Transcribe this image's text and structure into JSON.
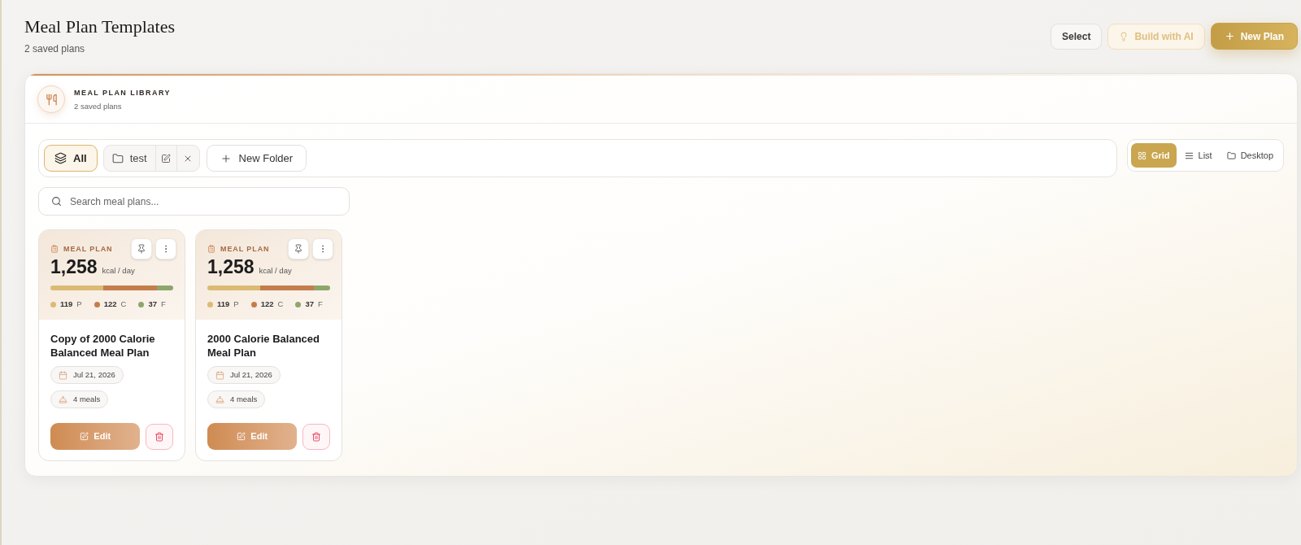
{
  "header": {
    "title": "Meal Plan Templates",
    "subtitle": "2 saved plans",
    "actions": [
      {
        "kind": "outline",
        "label": "Select",
        "disabled": false
      },
      {
        "kind": "ai",
        "label": "Build with AI",
        "disabled": true
      },
      {
        "kind": "primary",
        "label": "New Plan",
        "disabled": false
      }
    ]
  },
  "library": {
    "label": "MEAL PLAN LIBRARY",
    "subtitle": "2 saved plans"
  },
  "folders": {
    "items": [
      {
        "kind": "all",
        "label": "All",
        "selected": true
      },
      {
        "kind": "folder",
        "label": "test",
        "selected": false
      }
    ],
    "new_folder": "New Folder"
  },
  "views": [
    {
      "kind": "grid",
      "label": "Grid",
      "selected": true
    },
    {
      "kind": "list",
      "label": "List",
      "selected": false
    },
    {
      "kind": "desktop",
      "label": "Desktop",
      "selected": false
    }
  ],
  "search": {
    "placeholder": "Search meal plans..."
  },
  "plans": [
    {
      "tag": "MEAL PLAN",
      "calories": "1,258",
      "unit": "kcal / day",
      "macros": [
        {
          "value": "119",
          "letter": "P",
          "color": "#dbbb73"
        },
        {
          "value": "122",
          "letter": "C",
          "color": "#c47d4b"
        },
        {
          "value": "37",
          "letter": "F",
          "color": "#8ea66b"
        }
      ],
      "title": "Copy of 2000 Calorie Balanced Meal Plan",
      "date": "Jul 21, 2026",
      "meals": "4 meals",
      "edit": "Edit"
    },
    {
      "tag": "MEAL PLAN",
      "calories": "1,258",
      "unit": "kcal / day",
      "macros": [
        {
          "value": "119",
          "letter": "P",
          "color": "#dbbb73"
        },
        {
          "value": "122",
          "letter": "C",
          "color": "#c47d4b"
        },
        {
          "value": "37",
          "letter": "F",
          "color": "#8ea66b"
        }
      ],
      "title": "2000 Calorie Balanced Meal Plan",
      "date": "Jul 21, 2026",
      "meals": "4 meals",
      "edit": "Edit"
    }
  ]
}
